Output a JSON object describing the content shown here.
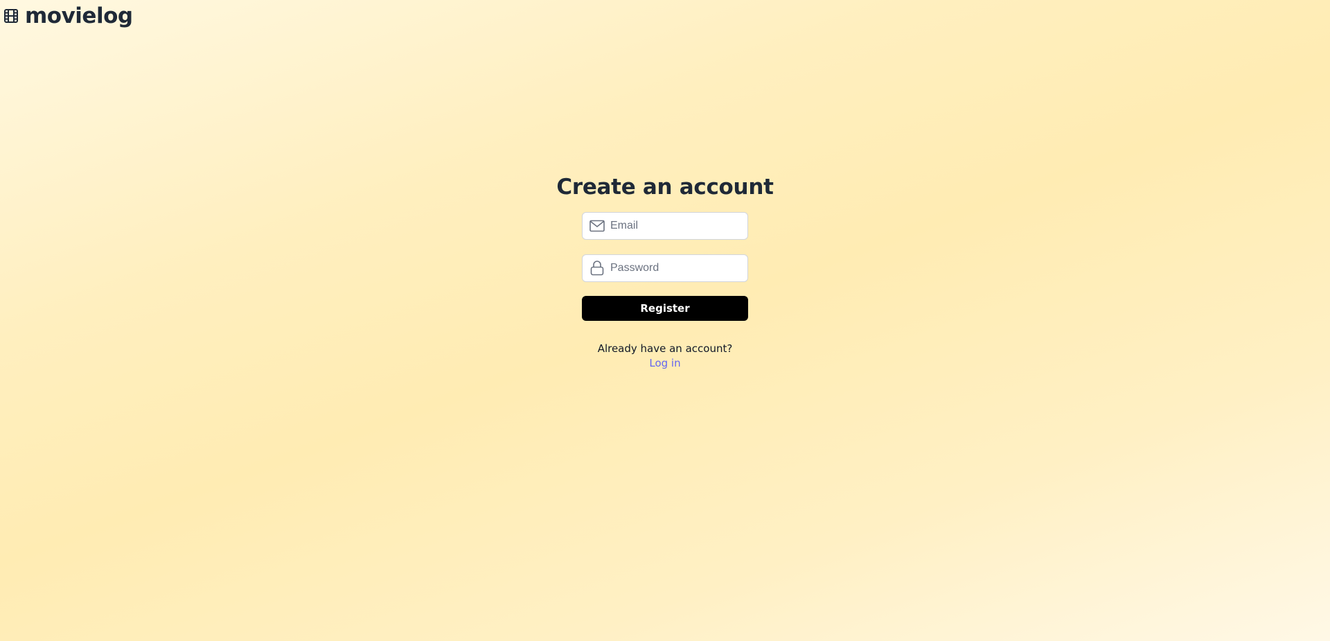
{
  "brand": {
    "name": "movielog",
    "icon": "film-icon"
  },
  "form": {
    "title": "Create an account",
    "email": {
      "icon": "envelope-icon",
      "placeholder": "Email",
      "value": ""
    },
    "password": {
      "icon": "lock-icon",
      "placeholder": "Password",
      "value": ""
    },
    "submit_label": "Register"
  },
  "footer": {
    "prompt": "Already have an account?",
    "link_label": "Log in"
  },
  "colors": {
    "background": "#ffecb3",
    "button": "#000000",
    "link": "#6366f1",
    "heading": "#1f2937"
  }
}
